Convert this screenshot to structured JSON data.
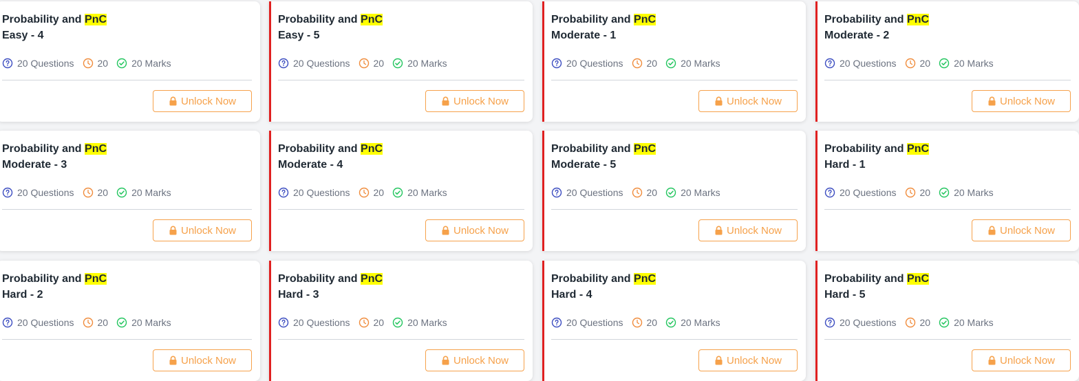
{
  "colors": {
    "accent": "#f6a14a",
    "highlight": "#ffff00",
    "question_icon": "#3b4cc0",
    "clock_icon": "#f08c3c",
    "check_icon": "#22c55e",
    "red_bar": "#e02020"
  },
  "icons": {
    "questions": "question-circle-icon",
    "time": "clock-icon",
    "marks": "check-circle-icon",
    "lock": "lock-icon"
  },
  "cards": [
    {
      "title_prefix": "Probability and",
      "title_highlight": "PnC",
      "level": "Easy - 4",
      "questions": "20 Questions",
      "time": "20",
      "marks": "20 Marks",
      "cta": "Unlock Now"
    },
    {
      "title_prefix": "Probability and",
      "title_highlight": "PnC",
      "level": "Easy - 5",
      "questions": "20 Questions",
      "time": "20",
      "marks": "20 Marks",
      "cta": "Unlock Now"
    },
    {
      "title_prefix": "Probability and",
      "title_highlight": "PnC",
      "level": "Moderate - 1",
      "questions": "20 Questions",
      "time": "20",
      "marks": "20 Marks",
      "cta": "Unlock Now"
    },
    {
      "title_prefix": "Probability and",
      "title_highlight": "PnC",
      "level": "Moderate - 2",
      "questions": "20 Questions",
      "time": "20",
      "marks": "20 Marks",
      "cta": "Unlock Now"
    },
    {
      "title_prefix": "Probability and",
      "title_highlight": "PnC",
      "level": "Moderate - 3",
      "questions": "20 Questions",
      "time": "20",
      "marks": "20 Marks",
      "cta": "Unlock Now"
    },
    {
      "title_prefix": "Probability and",
      "title_highlight": "PnC",
      "level": "Moderate - 4",
      "questions": "20 Questions",
      "time": "20",
      "marks": "20 Marks",
      "cta": "Unlock Now"
    },
    {
      "title_prefix": "Probability and",
      "title_highlight": "PnC",
      "level": "Moderate - 5",
      "questions": "20 Questions",
      "time": "20",
      "marks": "20 Marks",
      "cta": "Unlock Now"
    },
    {
      "title_prefix": "Probability and",
      "title_highlight": "PnC",
      "level": "Hard - 1",
      "questions": "20 Questions",
      "time": "20",
      "marks": "20 Marks",
      "cta": "Unlock Now"
    },
    {
      "title_prefix": "Probability and",
      "title_highlight": "PnC",
      "level": "Hard - 2",
      "questions": "20 Questions",
      "time": "20",
      "marks": "20 Marks",
      "cta": "Unlock Now"
    },
    {
      "title_prefix": "Probability and",
      "title_highlight": "PnC",
      "level": "Hard - 3",
      "questions": "20 Questions",
      "time": "20",
      "marks": "20 Marks",
      "cta": "Unlock Now"
    },
    {
      "title_prefix": "Probability and",
      "title_highlight": "PnC",
      "level": "Hard - 4",
      "questions": "20 Questions",
      "time": "20",
      "marks": "20 Marks",
      "cta": "Unlock Now"
    },
    {
      "title_prefix": "Probability and",
      "title_highlight": "PnC",
      "level": "Hard - 5",
      "questions": "20 Questions",
      "time": "20",
      "marks": "20 Marks",
      "cta": "Unlock Now"
    }
  ]
}
